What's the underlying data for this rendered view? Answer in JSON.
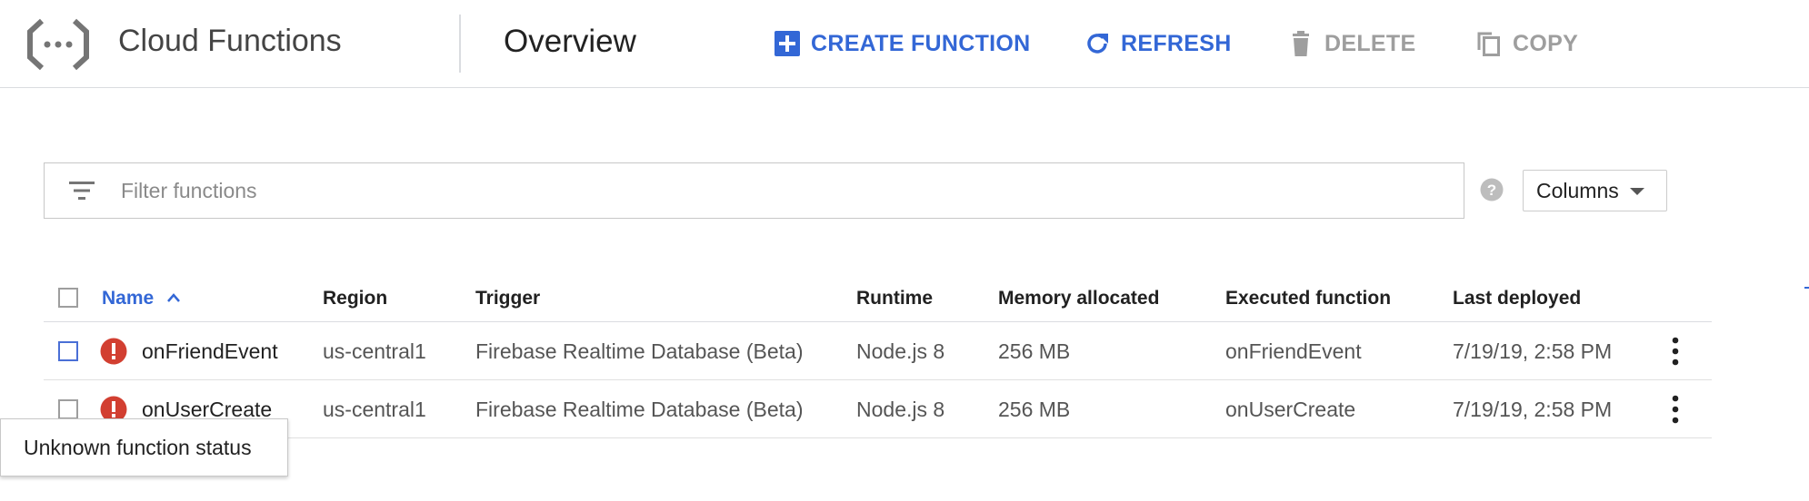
{
  "header": {
    "app_title": "Cloud Functions",
    "page_title": "Overview",
    "actions": {
      "create": {
        "label": "CREATE FUNCTION",
        "icon": "add-box-icon",
        "enabled": true
      },
      "refresh": {
        "label": "REFRESH",
        "icon": "refresh-icon",
        "enabled": true
      },
      "delete": {
        "label": "DELETE",
        "icon": "trash-icon",
        "enabled": false
      },
      "copy": {
        "label": "COPY",
        "icon": "copy-icon",
        "enabled": false
      }
    }
  },
  "filter": {
    "placeholder": "Filter functions",
    "value": "",
    "icon": "filter-list-icon",
    "help_icon": "help-icon"
  },
  "columns_button": {
    "label": "Columns",
    "icon": "caret-down-icon"
  },
  "table": {
    "columns": {
      "name": "Name",
      "region": "Region",
      "trigger": "Trigger",
      "runtime": "Runtime",
      "memory": "Memory allocated",
      "executed": "Executed function",
      "deployed": "Last deployed"
    },
    "sort": {
      "column": "Name",
      "direction": "ascending"
    },
    "rows": [
      {
        "status_icon": "error-icon",
        "name": "onFriendEvent",
        "region": "us-central1",
        "trigger": "Firebase Realtime Database (Beta)",
        "runtime": "Node.js 8",
        "memory": "256 MB",
        "executed": "onFriendEvent",
        "deployed": "7/19/19, 2:58 PM"
      },
      {
        "status_icon": "error-icon",
        "name": "onUserCreate",
        "region": "us-central1",
        "trigger": "Firebase Realtime Database (Beta)",
        "runtime": "Node.js 8",
        "memory": "256 MB",
        "executed": "onUserCreate",
        "deployed": "7/19/19, 2:58 PM"
      }
    ]
  },
  "tooltip": {
    "text": "Unknown function status"
  },
  "colors": {
    "accent": "#3367d6",
    "disabled": "#9e9e9e",
    "error": "#d23f31",
    "border": "#dadce0"
  }
}
